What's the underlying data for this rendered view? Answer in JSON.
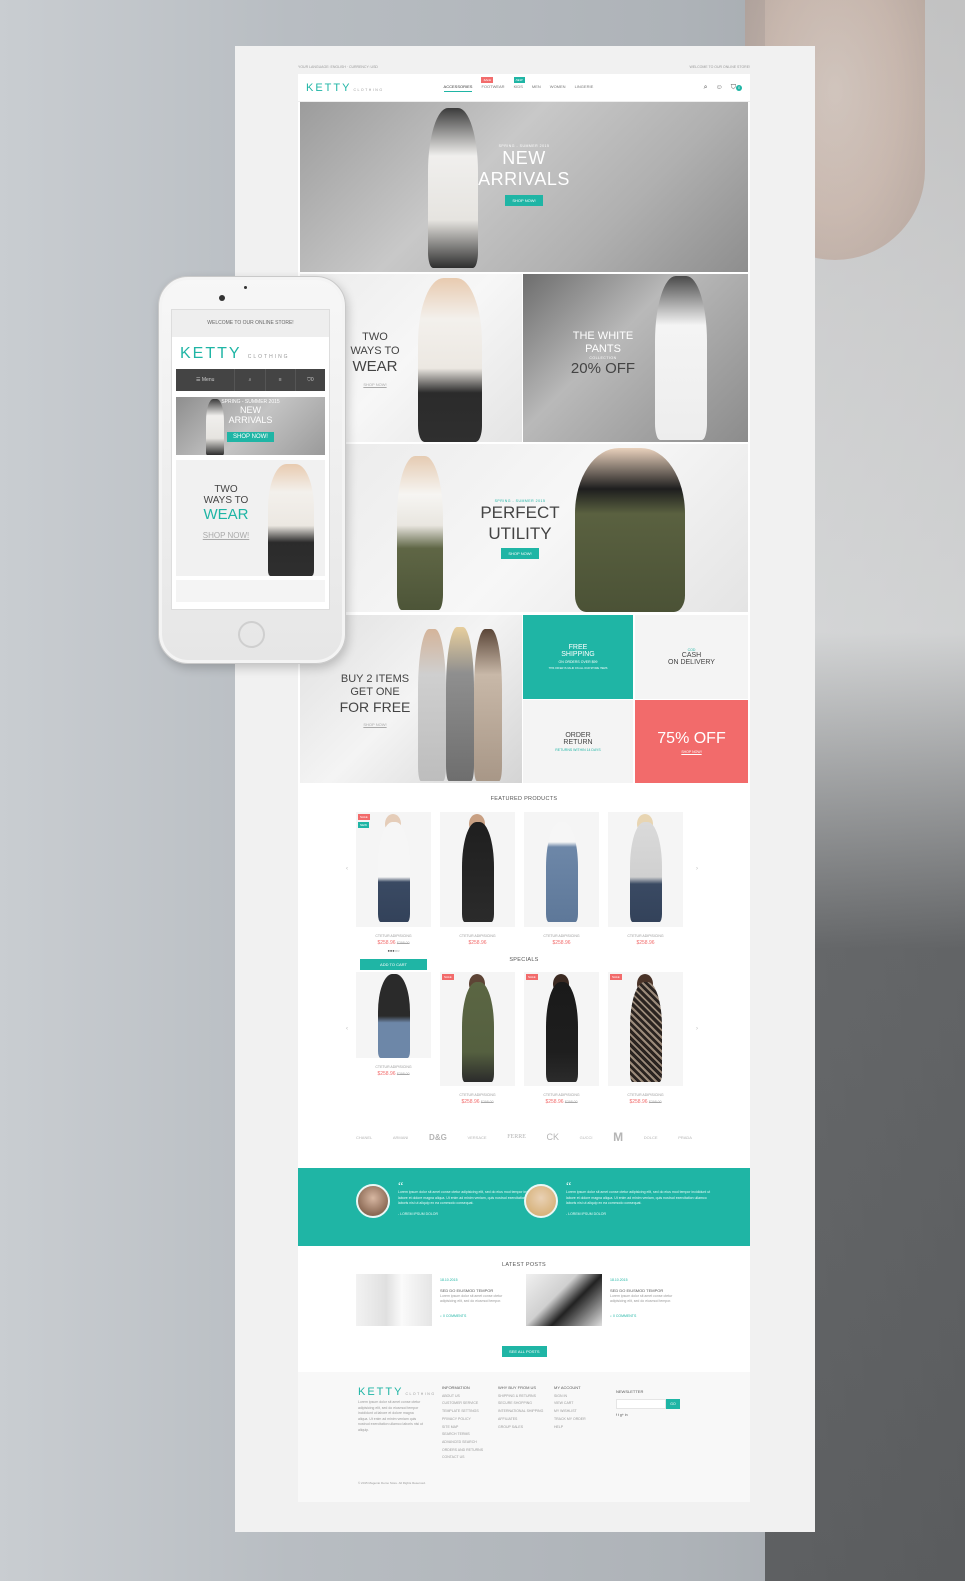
{
  "topbar": {
    "left": "YOUR LANGUAGE: ENGLISH  ·  CURRENCY: USD",
    "right": "WELCOME TO OUR ONLINE STORE!"
  },
  "brand": {
    "name": "KETTY",
    "tagline": "CLOTHING"
  },
  "nav": [
    {
      "label": "ACCESSORIES",
      "badge": ""
    },
    {
      "label": "FOOTWEAR",
      "badge": "SALE",
      "badge_color": "#f26b6b"
    },
    {
      "label": "KIDS",
      "badge": "NEW",
      "badge_color": "#1fb5a5"
    },
    {
      "label": "MEN",
      "badge": ""
    },
    {
      "label": "WOMEN",
      "badge": ""
    },
    {
      "label": "LINGERIE",
      "badge": ""
    }
  ],
  "cart_count": "0",
  "hero": {
    "eyebrow": "SPRING - SUMMER 2015",
    "line1": "NEW",
    "line2": "ARRIVALS",
    "cta": "SHOP NOW!"
  },
  "two_ways": {
    "line1": "TWO",
    "line2": "WAYS TO",
    "accent": "WEAR",
    "link": "SHOP NOW!"
  },
  "white_pants": {
    "line1": "THE WHITE",
    "line2": "PANTS",
    "sub": "COLLECTION",
    "accent": "20% OFF"
  },
  "utility": {
    "eyebrow": "SPRING - SUMMER 2015",
    "line1": "PERFECT",
    "line2": "UTILITY",
    "cta": "SHOP NOW!"
  },
  "buy2": {
    "line1": "BUY 2 ITEMS",
    "line2": "GET ONE",
    "accent": "FOR FREE",
    "link": "SHOP NOW!"
  },
  "shipping": {
    "line1": "FREE",
    "line2": "SHIPPING",
    "sub": "ON ORDERS OVER $99",
    "note": "THIS OFFER IS VALID ON ALL OUR STORE ITEMS"
  },
  "cod": {
    "eyebrow": "COD",
    "line1": "CASH",
    "line2": "ON DELIVERY"
  },
  "order_return": {
    "line1": "ORDER",
    "line2": "RETURN",
    "sub": "RETURNS WITHIN 14 DAYS"
  },
  "sale": {
    "label": "75% OFF",
    "link": "SHOP NOW!"
  },
  "featured_title": "FEATURED PRODUCTS",
  "featured": [
    {
      "name": "CTETUR ADIPISICING",
      "price": "$258.96",
      "old": "$298.00",
      "badges": [
        "SALE",
        "NEW"
      ]
    },
    {
      "name": "CTETUR ADIPISICING",
      "price": "$258.96",
      "old": "",
      "badges": []
    },
    {
      "name": "CTETUR ADIPISICING",
      "price": "$258.96",
      "old": "",
      "badges": []
    },
    {
      "name": "CTETUR ADIPISICING",
      "price": "$258.96",
      "old": "",
      "badges": []
    }
  ],
  "add_to_cart": "ADD TO CART",
  "specials_title": "SPECIALS",
  "specials": [
    {
      "name": "CTETUR ADIPISICING",
      "price": "$258.96",
      "old": "$298.00",
      "badge": ""
    },
    {
      "name": "CTETUR ADIPISICING",
      "price": "$258.96",
      "old": "$298.00",
      "badge": "SALE"
    },
    {
      "name": "CTETUR ADIPISICING",
      "price": "$258.96",
      "old": "$298.00",
      "badge": "SALE"
    },
    {
      "name": "CTETUR ADIPISICING",
      "price": "$258.96",
      "old": "$298.00",
      "badge": "SALE"
    }
  ],
  "brands": [
    "CHANEL",
    "ARMANI",
    "D&G",
    "VERSACE",
    "FERRE",
    "CK",
    "GUCCI",
    "M",
    "DOLCE",
    "PRADA"
  ],
  "testimonials": [
    {
      "text": "Lorem ipsum dolor sit amet conse ctetur adipisicing elit, sed do eius mod tempor incididunt ut labore et dolore magna aliqua. Ut enim ad minim veniam, quis nostrud exercitation ullamco laboris nisi ut aliquip ex ea commodo consequat.",
      "author": "- LOREM IPSUM DOLOR"
    },
    {
      "text": "Lorem ipsum dolor sit amet conse ctetur adipisicing elit, sed do eius mod tempor incididunt ut labore et dolore magna aliqua. Ut enim ad minim veniam, quis nostrud exercitation ullamco laboris nisi ut aliquip ex ea commodo consequat.",
      "author": "- LOREM IPSUM DOLOR"
    }
  ],
  "posts_title": "LATEST POSTS",
  "posts": [
    {
      "date": "18.10.2015",
      "title": "SED DO EIUSMOD TEMPOR",
      "body": "Lorem ipsum dolor sit amet conse ctetur adipisicing elit, sed do eiusmod tempor.",
      "comments": "0 COMMENTS"
    },
    {
      "date": "18.10.2015",
      "title": "SED DO EIUSMOD TEMPOR",
      "body": "Lorem ipsum dolor sit amet conse ctetur adipisicing elit, sed do eiusmod tempor.",
      "comments": "0 COMMENTS"
    }
  ],
  "see_all": "SEE ALL POSTS",
  "footer": {
    "about": "Lorem ipsum dolor sit amet conse ctetur adipisicing elit, sed do eiusmod tempor incididunt ut labore et dolore magna aliqua. Ut enim ad minim veniam quis nostrud exercitation ullamco laboris nisi ut aliquip.",
    "col1_title": "INFORMATION",
    "col1": [
      "ABOUT US",
      "CUSTOMER SERVICE",
      "TEMPLATE SETTINGS",
      "PRIVACY POLICY",
      "SITE MAP",
      "SEARCH TERMS",
      "ADVANCED SEARCH",
      "ORDERS AND RETURNS",
      "CONTACT US"
    ],
    "col2_title": "WHY BUY FROM US",
    "col2": [
      "SHIPPING & RETURNS",
      "SECURE SHOPPING",
      "INTERNATIONAL SHIPPING",
      "AFFILIATES",
      "GROUP SALES"
    ],
    "col3_title": "MY ACCOUNT",
    "col3": [
      "SIGN IN",
      "VIEW CART",
      "MY WISHLIST",
      "TRACK MY ORDER",
      "HELP"
    ],
    "newsletter_title": "NEWSLETTER",
    "newsletter_btn": "GO",
    "social": "f  t  g+  in",
    "copyright": "© 2015 Magento Demo Store. All Rights Reserved."
  },
  "mobile": {
    "welcome": "WELCOME TO OUR ONLINE STORE!",
    "menu": "Menu",
    "cart": "0",
    "banner_eyebrow": "SPRING - SUMMER 2015",
    "banner_line1": "NEW",
    "banner_line2": "ARRIVALS",
    "banner_cta": "SHOP NOW!",
    "two_line1": "TWO",
    "two_line2": "WAYS TO",
    "two_accent": "WEAR",
    "two_link": "SHOP NOW!"
  },
  "colors": {
    "accent": "#1fb5a5",
    "sale": "#f26b6b",
    "dark": "#444444"
  }
}
